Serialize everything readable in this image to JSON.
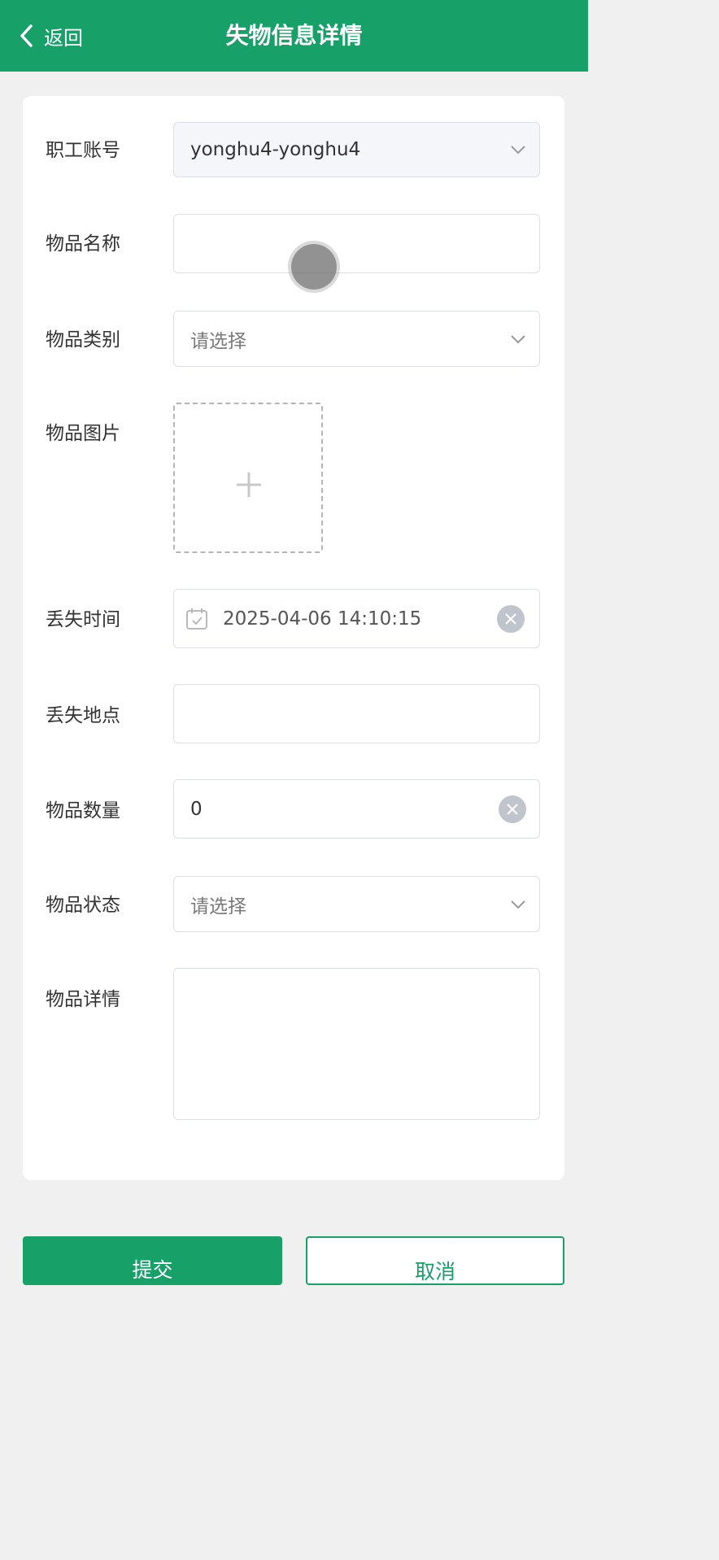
{
  "header": {
    "back_label": "返回",
    "title": "失物信息详情"
  },
  "form": {
    "account": {
      "label": "职工账号",
      "value": "yonghu4-yonghu4"
    },
    "item_name": {
      "label": "物品名称",
      "value": ""
    },
    "category": {
      "label": "物品类别",
      "placeholder": "请选择"
    },
    "image": {
      "label": "物品图片"
    },
    "lost_time": {
      "label": "丢失时间",
      "value": "2025-04-06 14:10:15"
    },
    "lost_place": {
      "label": "丢失地点",
      "value": ""
    },
    "quantity": {
      "label": "物品数量",
      "value": "0"
    },
    "status": {
      "label": "物品状态",
      "placeholder": "请选择"
    },
    "details": {
      "label": "物品详情",
      "value": ""
    }
  },
  "actions": {
    "submit_label": "提交",
    "cancel_label": "取消"
  },
  "colors": {
    "brand": "#17a068",
    "clear_icon": "#c0c4cc"
  },
  "icons": [
    "chevron-left-icon",
    "chevron-down-icon",
    "calendar-icon",
    "clear-icon",
    "plus-icon"
  ]
}
